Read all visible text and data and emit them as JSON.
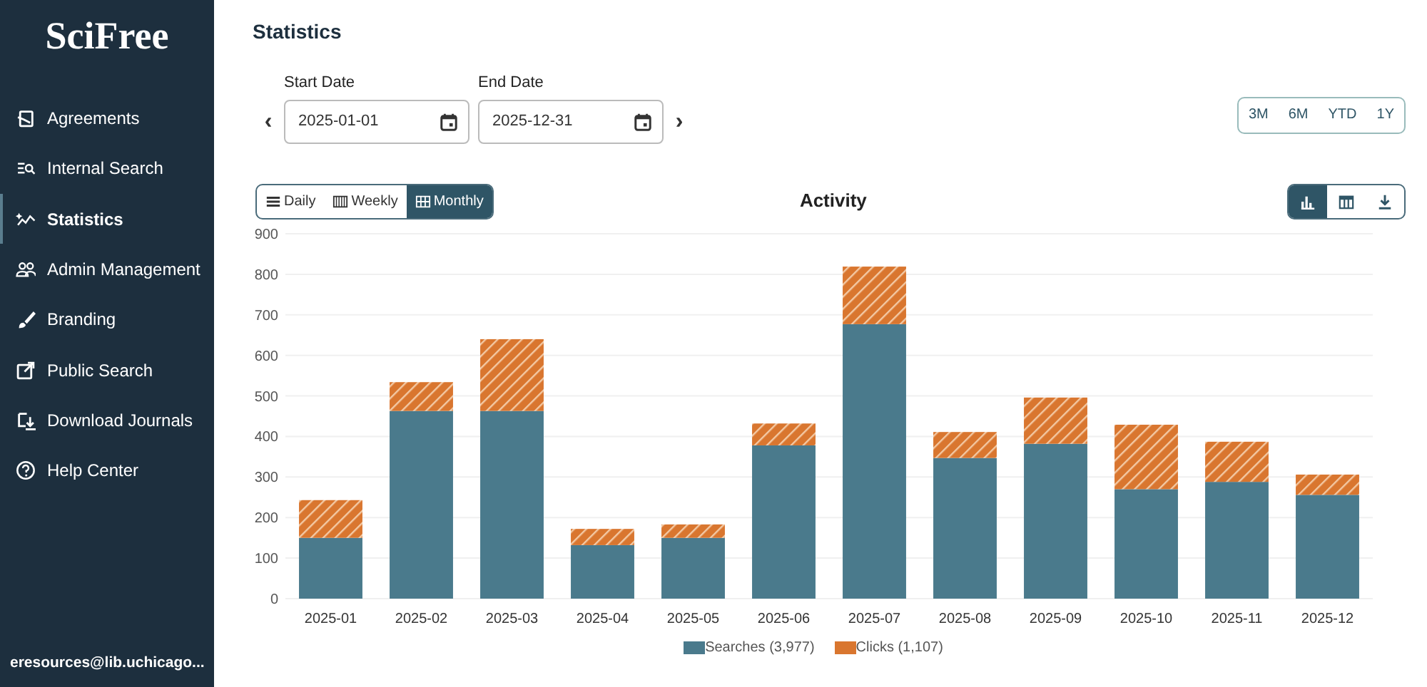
{
  "sidebar": {
    "logo": "SciFree",
    "items": [
      {
        "label": "Agreements",
        "selected": false
      },
      {
        "label": "Internal Search",
        "selected": false
      },
      {
        "label": "Statistics",
        "selected": true
      },
      {
        "label": "Admin Management",
        "selected": false
      },
      {
        "label": "Branding",
        "selected": false
      },
      {
        "label": "Public Search",
        "selected": false
      },
      {
        "label": "Download Journals",
        "selected": false
      },
      {
        "label": "Help Center",
        "selected": false
      }
    ],
    "user": "eresources@lib.uchicago..."
  },
  "page_title": "Statistics",
  "start_date": {
    "label": "Start Date",
    "value": "2025-01-01"
  },
  "end_date": {
    "label": "End Date",
    "value": "2025-12-31"
  },
  "prev": "‹",
  "next": "›",
  "ranges": [
    {
      "label": "3M",
      "selected": false
    },
    {
      "label": "6M",
      "selected": false
    },
    {
      "label": "YTD",
      "selected": false
    },
    {
      "label": "1Y",
      "selected": false
    }
  ],
  "granularity": [
    {
      "label": "Daily",
      "selected": false
    },
    {
      "label": "Weekly",
      "selected": false
    },
    {
      "label": "Monthly",
      "selected": true
    }
  ],
  "chart_title": "Activity",
  "views": [
    {
      "kind": "bar",
      "selected": true
    },
    {
      "kind": "table",
      "selected": false
    },
    {
      "kind": "download",
      "selected": false
    }
  ],
  "chart_data": {
    "type": "bar",
    "stacked": true,
    "grid": true,
    "categories": [
      "2025-01",
      "2025-02",
      "2025-03",
      "2025-04",
      "2025-05",
      "2025-06",
      "2025-07",
      "2025-08",
      "2025-09",
      "2025-10",
      "2025-11",
      "2025-12"
    ],
    "series": [
      {
        "name": "Searches (3,977)",
        "color": "#4a7a8c",
        "values": [
          150,
          463,
          463,
          132,
          150,
          378,
          677,
          347,
          382,
          270,
          288,
          256
        ]
      },
      {
        "name": "Clicks (1,107)",
        "color": "#d9762f",
        "values": [
          93,
          71,
          177,
          40,
          33,
          54,
          142,
          64,
          114,
          159,
          99,
          50
        ]
      }
    ],
    "ylim": [
      0,
      900
    ],
    "yticks": [
      0,
      100,
      200,
      300,
      400,
      500,
      600,
      700,
      800,
      900
    ]
  }
}
